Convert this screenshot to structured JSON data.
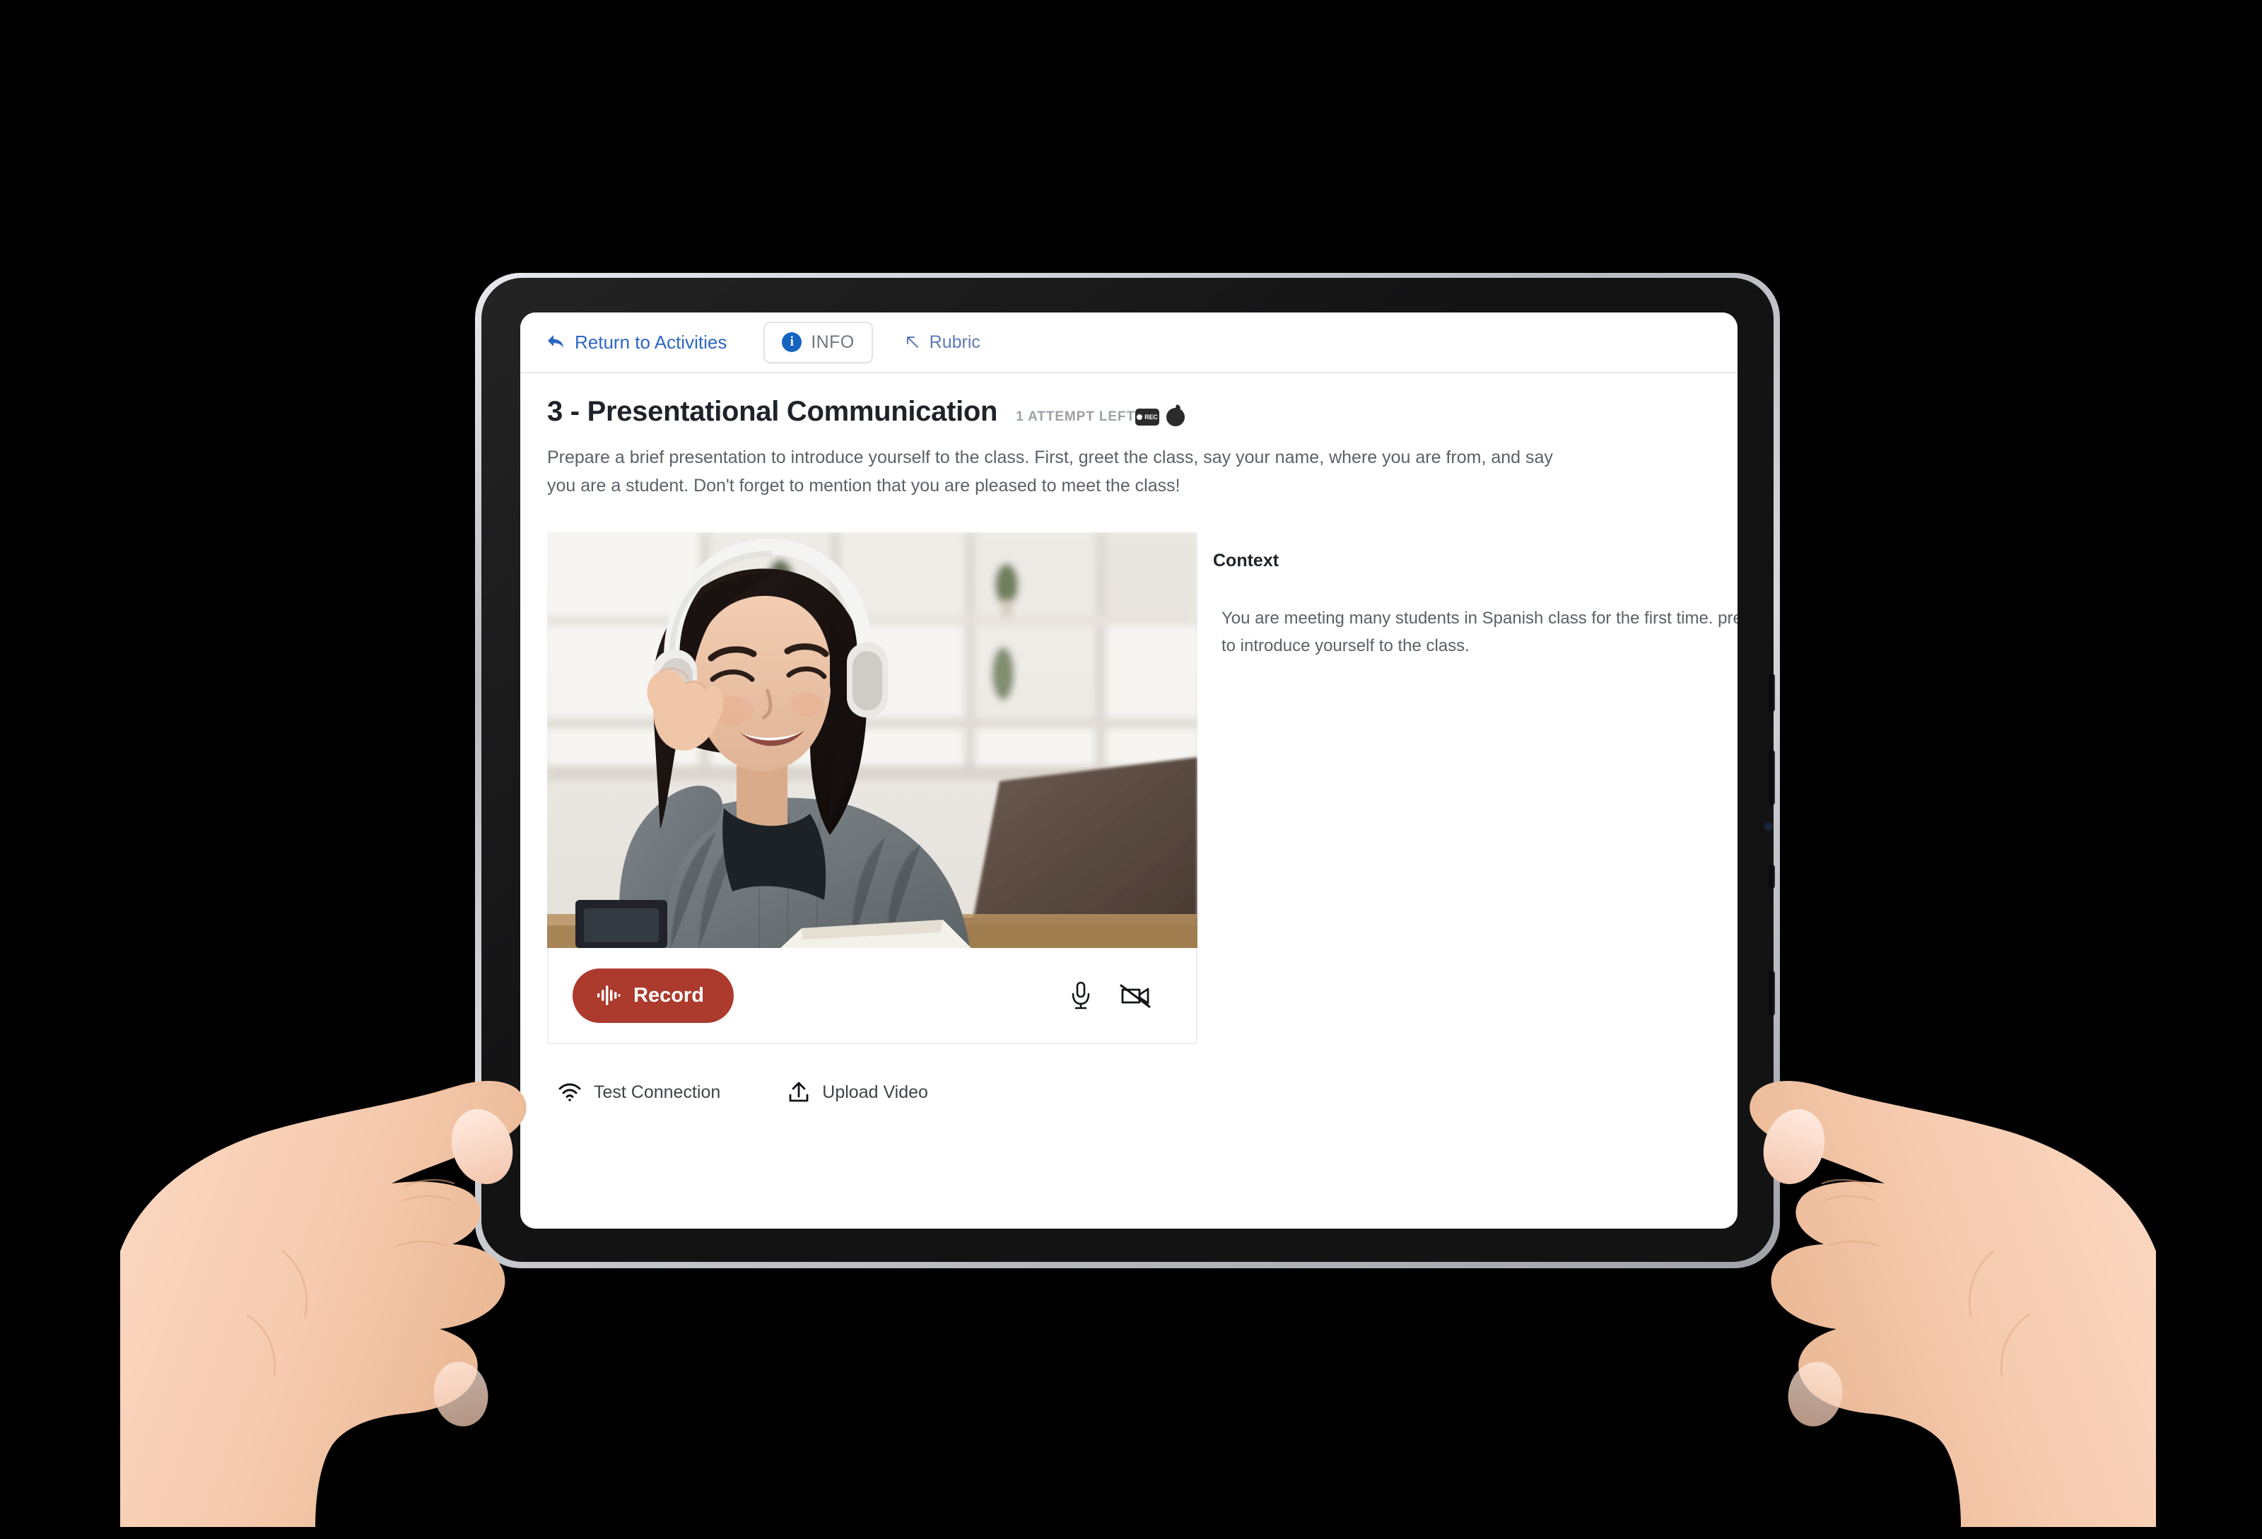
{
  "nav": {
    "return_label": "Return to Activities",
    "return_icon": "back-arrow-icon",
    "tabs": [
      {
        "label": "INFO",
        "icon": "info-circle-icon",
        "active": true
      },
      {
        "label": "Rubric",
        "icon": "arrow-up-left-icon",
        "active": false
      }
    ]
  },
  "header": {
    "title": "3 - Presentational Communication",
    "attempt_badge": "1 ATTEMPT LEFT",
    "badge_icons": [
      "rec-chip-icon",
      "apple-dot-icon"
    ]
  },
  "instructions": "Prepare a brief presentation to introduce yourself to the class. First, greet the class, say your name, where you are from, and say you are a student. Don't forget to mention that you are pleased to meet the class!",
  "context": {
    "heading": "Context",
    "body": "You are meeting many students in Spanish class for the first time. presentation to introduce yourself to the class."
  },
  "recorder": {
    "record_label": "Record",
    "record_icon": "waveform-icon",
    "mic_icon": "microphone-icon",
    "camera_icon": "camera-off-icon"
  },
  "actions": [
    {
      "label": "Test Connection",
      "icon": "wifi-icon"
    },
    {
      "label": "Upload Video",
      "icon": "upload-icon"
    }
  ],
  "colors": {
    "record_red": "#ac3a2d",
    "link_blue": "#2d66c3",
    "info_blue": "#1565c0",
    "title_dark": "#1f2329",
    "body_gray": "#5b6168"
  }
}
